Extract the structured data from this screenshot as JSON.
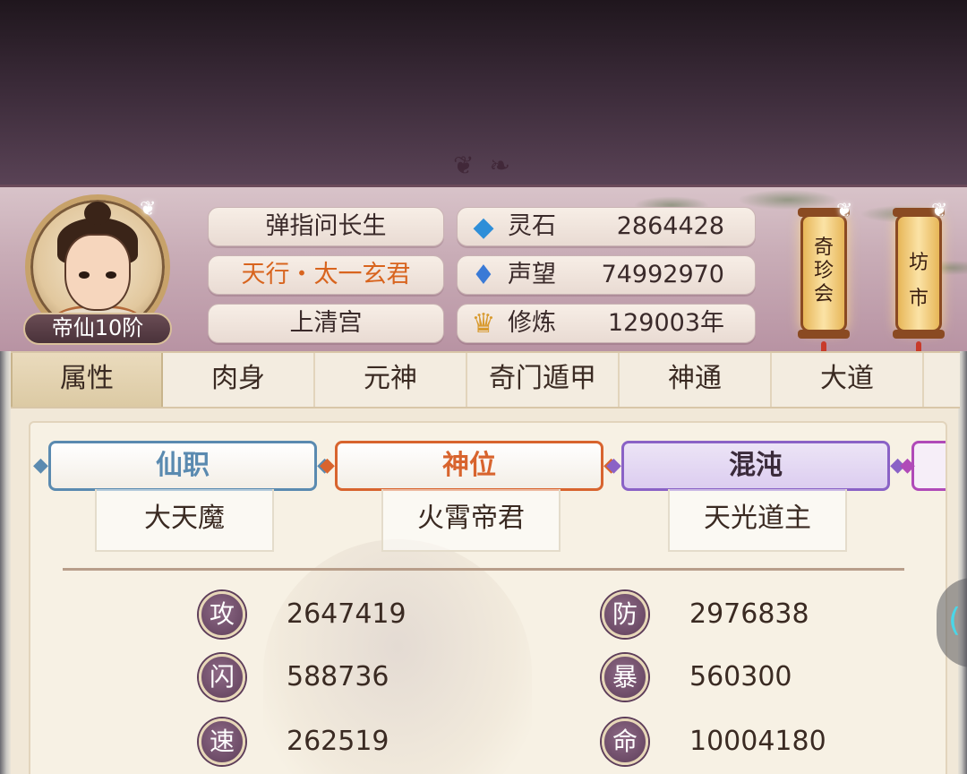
{
  "player": {
    "rank": "帝仙10阶",
    "name": "弹指问长生",
    "title": "天行・太一玄君",
    "sect": "上清宫"
  },
  "resources": [
    {
      "icon": "spirit-stone-icon",
      "label": "灵石",
      "value": "2864428"
    },
    {
      "icon": "reputation-icon",
      "label": "声望",
      "value": "74992970"
    },
    {
      "icon": "cultivation-icon",
      "label": "修炼",
      "value": "129003年"
    }
  ],
  "lanterns": [
    {
      "label": "奇珍会"
    },
    {
      "label": "坊市"
    }
  ],
  "tabs": [
    {
      "label": "属性",
      "active": true
    },
    {
      "label": "肉身"
    },
    {
      "label": "元神"
    },
    {
      "label": "奇门遁甲"
    },
    {
      "label": "神通"
    },
    {
      "label": "大道"
    }
  ],
  "titles": [
    {
      "label": "仙职",
      "value": "大天魔",
      "color": "#5a8ab0"
    },
    {
      "label": "神位",
      "value": "火霄帝君",
      "color": "#d8642e"
    },
    {
      "label": "混沌",
      "value": "天光道主",
      "color": "#8a62c6"
    }
  ],
  "attributes": [
    {
      "name": "攻",
      "value": "2647419"
    },
    {
      "name": "防",
      "value": "2976838"
    },
    {
      "name": "闪",
      "value": "588736"
    },
    {
      "name": "暴",
      "value": "560300"
    },
    {
      "name": "速",
      "value": "262519"
    },
    {
      "name": "命",
      "value": "10004180"
    }
  ],
  "colors": {
    "accent_orange": "#d8641e",
    "badge_purple": "#5e3e5a",
    "header_bg": "#c9adb7"
  }
}
